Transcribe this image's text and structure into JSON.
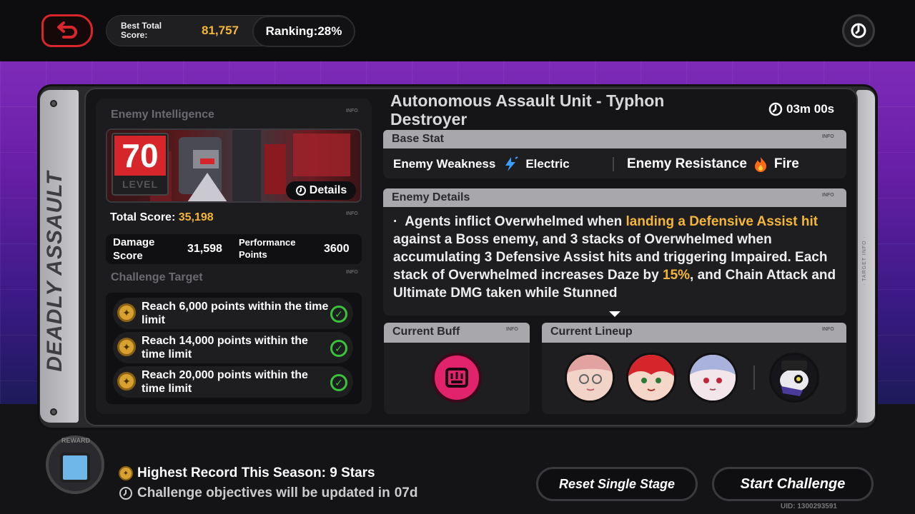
{
  "topbar": {
    "best_total_score_label": "Best Total Score:",
    "best_total_score_value": "81,757",
    "ranking": "Ranking:28%"
  },
  "side_title": "DEADLY ASSAULT",
  "right_strip_text": "· TARGET INFO ·",
  "enemy_intelligence": {
    "title": "Enemy Intelligence",
    "info": "INFO",
    "level": "70",
    "level_label": "LEVEL",
    "details_button": "Details"
  },
  "scores": {
    "total_label": "Total Score:",
    "total_value": "35,198",
    "info": "INFO",
    "damage_label": "Damage Score",
    "damage_value": "31,598",
    "performance_label": "Performance Points",
    "performance_value": "3600"
  },
  "challenge": {
    "title": "Challenge Target",
    "info": "INFO",
    "targets": [
      {
        "text": "Reach 6,000 points within the time limit"
      },
      {
        "text": "Reach 14,000 points within the time limit"
      },
      {
        "text": "Reach 20,000 points within the time limit"
      }
    ]
  },
  "enemy": {
    "name": "Autonomous Assault Unit - Typhon Destroyer",
    "time": "03m 00s"
  },
  "base_stat": {
    "title": "Base Stat",
    "info": "INFO",
    "weakness_label": "Enemy Weakness",
    "weakness_value": "Electric",
    "resistance_label": "Enemy Resistance",
    "resistance_value": "Fire"
  },
  "enemy_details": {
    "title": "Enemy Details",
    "info": "INFO",
    "bullet": "·",
    "t1": "Agents inflict Overwhelmed when ",
    "t2": "landing a Defensive Assist hit",
    "t3": " against a Boss enemy, and 3 stacks of Overwhelmed when accumulating 3 Defensive Assist hits and triggering Impaired. Each stack of Overwhelmed increases Daze by ",
    "t4": "15%",
    "t5": ", and Chain Attack and Ultimate DMG taken while Stunned"
  },
  "buff": {
    "title": "Current Buff",
    "info": "INFO"
  },
  "lineup": {
    "title": "Current Lineup",
    "info": "INFO"
  },
  "bottom": {
    "reward_label": "REWARD",
    "highest_record": "Highest Record This Season: 9 Stars",
    "objectives": "Challenge objectives will be updated in",
    "objectives_days": "07d",
    "reset_button": "Reset Single Stage",
    "start_button": "Start Challenge",
    "uid": "UID: 1300293591"
  },
  "colors": {
    "accent_gold": "#f4b63a",
    "accent_red": "#d7262b",
    "electric_blue": "#3aa0ff",
    "fire_orange": "#ff6a1a",
    "check_green": "#3ac23a"
  }
}
